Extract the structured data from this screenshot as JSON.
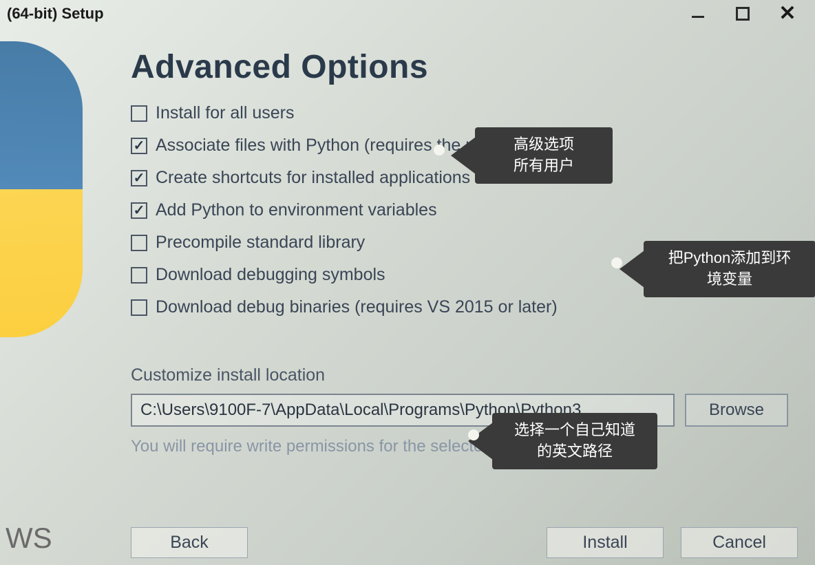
{
  "titlebar": {
    "title": "(64-bit) Setup"
  },
  "heading": "Advanced Options",
  "checkboxes": [
    {
      "label": "Install for all users",
      "checked": false
    },
    {
      "label": "Associate files with Python (requires the py launcher)",
      "checked": true
    },
    {
      "label": "Create shortcuts for installed applications",
      "checked": true
    },
    {
      "label": "Add Python to environment variables",
      "checked": true
    },
    {
      "label": "Precompile standard library",
      "checked": false
    },
    {
      "label": "Download debugging symbols",
      "checked": false
    },
    {
      "label": "Download debug binaries (requires VS 2015 or later)",
      "checked": false
    }
  ],
  "annotations": {
    "a1": "高级选项\n所有用户",
    "a2": "把Python添加到环境变量",
    "a3": "选择一个自己知道的英文路径"
  },
  "location": {
    "label": "Customize install location",
    "path": "C:\\Users\\9100F-7\\AppData\\Local\\Programs\\Python\\Python3",
    "browse": "Browse",
    "note": "You will require write permissions for the selected location."
  },
  "buttons": {
    "back": "Back",
    "install": "Install",
    "cancel": "Cancel"
  },
  "sidebar_text": "WS"
}
